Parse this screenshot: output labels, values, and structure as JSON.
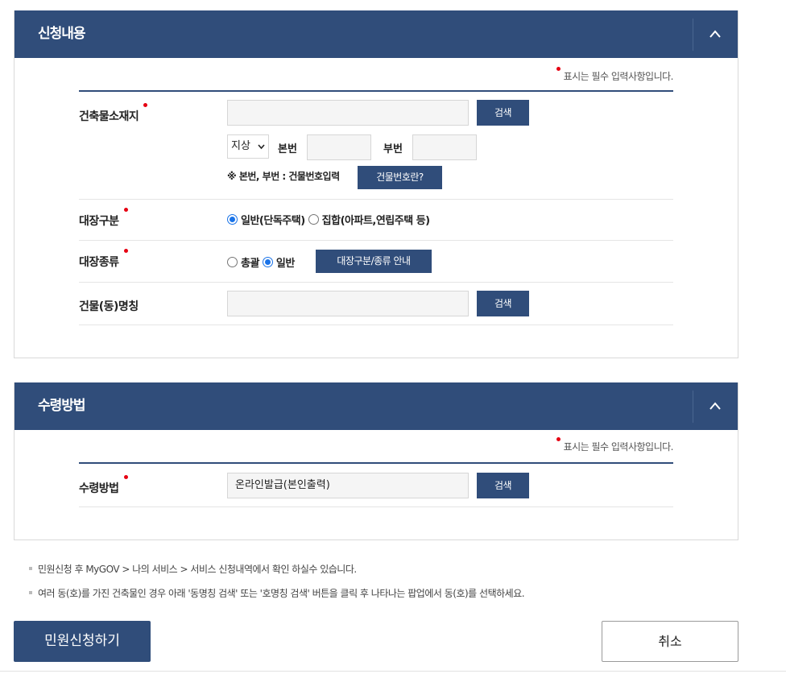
{
  "application": {
    "title": "신청내용",
    "required_note": "표시는 필수 입력사항입니다.",
    "building_location": {
      "label": "건축물소재지",
      "address_value": "",
      "search_button": "검색",
      "ground_select": "지상",
      "main_no_label": "본번",
      "main_no_value": "",
      "sub_no_label": "부번",
      "sub_no_value": "",
      "hint": "※ 본번, 부번 : 건물번호입력",
      "building_no_button": "건물번호란?"
    },
    "register_category": {
      "label": "대장구분",
      "options": [
        "일반(단독주택)",
        "집합(아파트,연립주택 등)"
      ],
      "selected": "일반(단독주택)"
    },
    "register_type": {
      "label": "대장종류",
      "options": [
        "총괄",
        "일반"
      ],
      "selected": "일반",
      "guide_button": "대장구분/종류 안내"
    },
    "building_name": {
      "label": "건물(동)명칭",
      "value": "",
      "search_button": "검색"
    }
  },
  "receipt": {
    "title": "수령방법",
    "required_note": "표시는 필수 입력사항입니다.",
    "method": {
      "label": "수령방법",
      "value": "온라인발급(본인출력)",
      "search_button": "검색"
    }
  },
  "notes": [
    "민원신청 후 MyGOV > 나의 서비스 > 서비스 신청내역에서 확인 하실수 있습니다.",
    "여러 동(호)를 가진 건축물인 경우 아래 '동명칭 검색' 또는 '호명칭 검색' 버튼을 클릭 후 나타나는 팝업에서 동(호)를 선택하세요."
  ],
  "actions": {
    "submit": "민원신청하기",
    "cancel": "취소"
  },
  "colors": {
    "header": "#304d7a",
    "required_dot": "#e60012",
    "radio_checked": "#1a73e8"
  }
}
